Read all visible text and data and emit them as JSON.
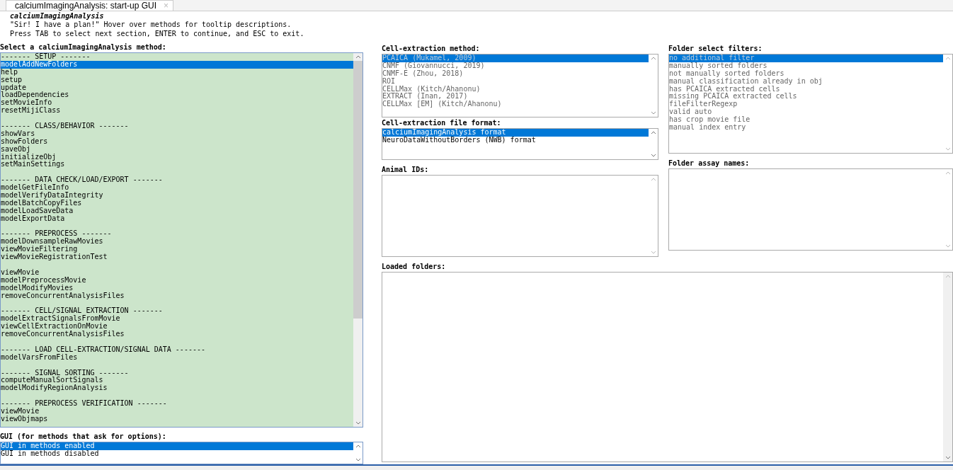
{
  "tab": {
    "title": "calciumImagingAnalysis: start-up GUI",
    "close": "×"
  },
  "header": {
    "title": "calciumImagingAnalysis",
    "lines": [
      "\"Sir! I have a plan!\" Hover over methods for tooltip descriptions.",
      "Press TAB to select next section, ENTER to continue, and ESC to exit."
    ]
  },
  "method_list": {
    "label": "Select a calciumImagingAnalysis method:",
    "sections": [
      {
        "header": "------- SETUP -------",
        "items": [
          {
            "label": "modelAddNewFolders",
            "selected": true
          },
          {
            "label": "help",
            "selected": false
          },
          {
            "label": "setup",
            "selected": false
          },
          {
            "label": "update",
            "selected": false
          },
          {
            "label": "loadDependencies",
            "selected": false
          },
          {
            "label": "setMovieInfo",
            "selected": false
          },
          {
            "label": "resetMijiClass",
            "selected": false
          }
        ]
      },
      {
        "header": "------- CLASS/BEHAVIOR -------",
        "items": [
          {
            "label": "showVars",
            "selected": false
          },
          {
            "label": "showFolders",
            "selected": false
          },
          {
            "label": "saveObj",
            "selected": false
          },
          {
            "label": "initializeObj",
            "selected": false
          },
          {
            "label": "setMainSettings",
            "selected": false
          }
        ]
      },
      {
        "header": "------- DATA CHECK/LOAD/EXPORT -------",
        "items": [
          {
            "label": "modelGetFileInfo",
            "selected": false
          },
          {
            "label": "modelVerifyDataIntegrity",
            "selected": false
          },
          {
            "label": "modelBatchCopyFiles",
            "selected": false
          },
          {
            "label": "modelLoadSaveData",
            "selected": false
          },
          {
            "label": "modelExportData",
            "selected": false
          }
        ]
      },
      {
        "header": "------- PREPROCESS -------",
        "items": [
          {
            "label": "modelDownsampleRawMovies",
            "selected": false
          },
          {
            "label": "viewMovieFiltering",
            "selected": false
          },
          {
            "label": "viewMovieRegistrationTest",
            "selected": false
          }
        ]
      },
      {
        "items": [
          {
            "label": "viewMovie",
            "selected": false
          },
          {
            "label": "modelPreprocessMovie",
            "selected": false
          },
          {
            "label": "modelModifyMovies",
            "selected": false
          },
          {
            "label": "removeConcurrentAnalysisFiles",
            "selected": false
          }
        ]
      },
      {
        "header": "------- CELL/SIGNAL EXTRACTION -------",
        "items": [
          {
            "label": "modelExtractSignalsFromMovie",
            "selected": false
          },
          {
            "label": "viewCellExtractionOnMovie",
            "selected": false
          },
          {
            "label": "removeConcurrentAnalysisFiles",
            "selected": false
          }
        ]
      },
      {
        "header": "------- LOAD CELL-EXTRACTION/SIGNAL DATA -------",
        "items": [
          {
            "label": "modelVarsFromFiles",
            "selected": false
          }
        ]
      },
      {
        "header": "------- SIGNAL SORTING -------",
        "items": [
          {
            "label": "computeManualSortSignals",
            "selected": false
          },
          {
            "label": "modelModifyRegionAnalysis",
            "selected": false
          }
        ]
      },
      {
        "header": "------- PREPROCESS VERIFICATION -------",
        "items": [
          {
            "label": "viewMovie",
            "selected": false
          },
          {
            "label": "viewObjmaps",
            "selected": false
          }
        ]
      }
    ]
  },
  "gui_list": {
    "label": "GUI (for methods that ask for options):",
    "disabled": false,
    "items": [
      {
        "label": "GUI in methods enabled",
        "selected": true
      },
      {
        "label": "GUI in methods disabled",
        "selected": false
      }
    ]
  },
  "cell_extraction_method": {
    "label": "Cell-extraction method:",
    "disabled": true,
    "items": [
      {
        "label": "PCAICA (Mukamel, 2009)",
        "selected": true
      },
      {
        "label": "CNMF (Giovannucci, 2019)",
        "selected": false
      },
      {
        "label": "CNMF-E (Zhou, 2018)",
        "selected": false
      },
      {
        "label": "ROI",
        "selected": false
      },
      {
        "label": "CELLMax (Kitch/Ahanonu)",
        "selected": false
      },
      {
        "label": "EXTRACT (Inan, 2017)",
        "selected": false
      },
      {
        "label": "CELLMax [EM] (Kitch/Ahanonu)",
        "selected": false
      }
    ]
  },
  "file_format": {
    "label": "Cell-extraction file format:",
    "disabled": false,
    "items": [
      {
        "label": "calciumImagingAnalysis format",
        "selected": true
      },
      {
        "label": "NeuroDataWithoutBorders (NWB) format",
        "selected": false
      }
    ]
  },
  "folder_filters": {
    "label": "Folder select filters:",
    "disabled": true,
    "items": [
      {
        "label": "no additional filter",
        "selected": true
      },
      {
        "label": "manually sorted folders",
        "selected": false
      },
      {
        "label": "not manually sorted folders",
        "selected": false
      },
      {
        "label": "manual classification already in obj",
        "selected": false
      },
      {
        "label": "has PCAICA extracted cells",
        "selected": false
      },
      {
        "label": "missing PCAICA extracted cells",
        "selected": false
      },
      {
        "label": "fileFilterRegexp",
        "selected": false
      },
      {
        "label": "valid auto",
        "selected": false
      },
      {
        "label": "has crop movie file",
        "selected": false
      },
      {
        "label": "manual index entry",
        "selected": false
      }
    ]
  },
  "animal_ids": {
    "label": "Animal IDs:"
  },
  "folder_assay_names": {
    "label": "Folder assay names:"
  },
  "loaded_folders": {
    "label": "Loaded folders:"
  }
}
